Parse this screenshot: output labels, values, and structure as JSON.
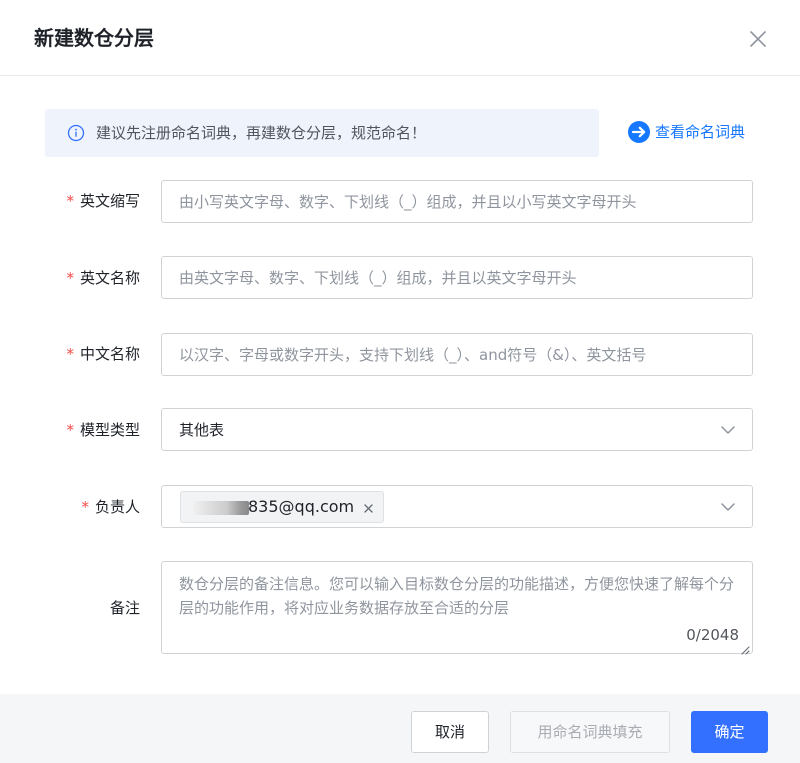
{
  "dialog": {
    "title": "新建数仓分层"
  },
  "notice": {
    "text": "建议先注册命名词典，再建数仓分层，规范命名！",
    "link_text": "查看命名词典"
  },
  "form": {
    "required_mark": "*",
    "abbr": {
      "label": "英文缩写",
      "placeholder": "由小写英文字母、数字、下划线（_）组成，并且以小写英文字母开头"
    },
    "en_name": {
      "label": "英文名称",
      "placeholder": "由英文字母、数字、下划线（_）组成，并且以英文字母开头"
    },
    "cn_name": {
      "label": "中文名称",
      "placeholder": "以汉字、字母或数字开头，支持下划线（_）、and符号（&）、英文括号"
    },
    "model_type": {
      "label": "模型类型",
      "value": "其他表"
    },
    "owner": {
      "label": "负责人",
      "tag_text": "835@qq.com"
    },
    "remark": {
      "label": "备注",
      "placeholder": "数仓分层的备注信息。您可以输入目标数仓分层的功能描述，方便您快速了解每个分层的功能作用，将对应业务数据存放至合适的分层",
      "counter": "0/2048"
    }
  },
  "footer": {
    "cancel_label": "取消",
    "fill_label": "用命名词典填充",
    "confirm_label": "确定"
  },
  "colors": {
    "primary": "#3370ff",
    "required": "#f54a45",
    "info_bg": "#eef3fc"
  }
}
